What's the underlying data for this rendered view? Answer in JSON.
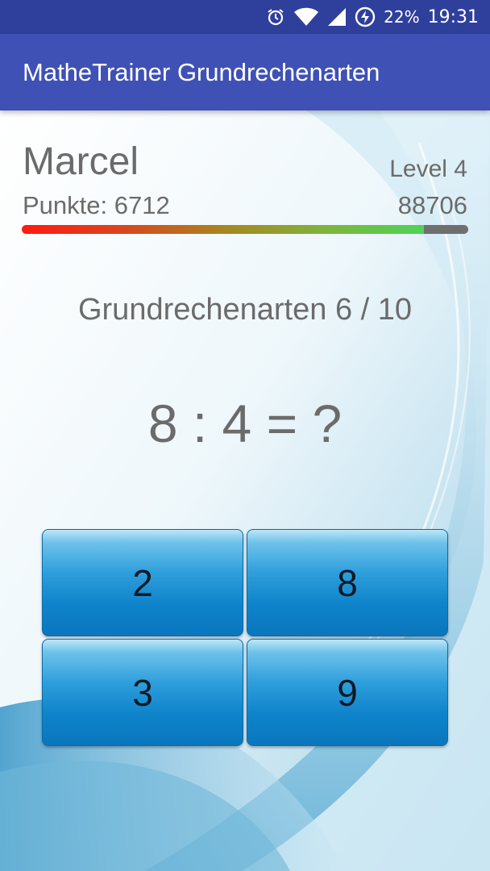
{
  "status_bar": {
    "battery": "22%",
    "time": "19:31",
    "icons": [
      "alarm-icon",
      "wifi-icon",
      "cell-signal-icon",
      "battery-charging-icon"
    ]
  },
  "app_bar": {
    "title": "MatheTrainer Grundrechenarten"
  },
  "player": {
    "name": "Marcel",
    "level": "Level 4",
    "points": "Punkte: 6712",
    "next_level_points": "88706",
    "progress": 0.9
  },
  "quiz": {
    "round": "Grundrechenarten 6 / 10",
    "question": "8 : 4 = ?",
    "answers": [
      "2",
      "8",
      "3",
      "9"
    ]
  },
  "colors": {
    "status_bar": "#2f3f9c",
    "app_bar": "#3f51b5",
    "text_gray": "#6b6b6b",
    "button_blue": "#0f84cb"
  }
}
